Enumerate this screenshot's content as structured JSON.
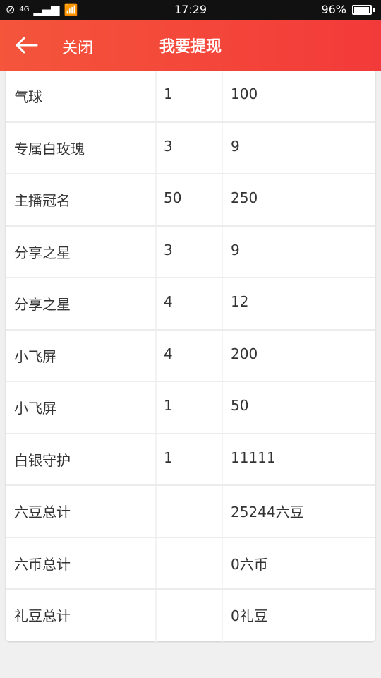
{
  "status": {
    "time": "17:29",
    "battery": "96%",
    "network": "4G"
  },
  "header": {
    "close_label": "关闭",
    "title": "我要提现"
  },
  "table": {
    "rows": [
      {
        "name": "气球",
        "qty": "1",
        "value": "100"
      },
      {
        "name": "专属白玫瑰",
        "qty": "3",
        "value": "9"
      },
      {
        "name": "主播冠名",
        "qty": "50",
        "value": "250"
      },
      {
        "name": "分享之星",
        "qty": "3",
        "value": "9"
      },
      {
        "name": "分享之星",
        "qty": "4",
        "value": "12"
      },
      {
        "name": "小飞屏",
        "qty": "4",
        "value": "200"
      },
      {
        "name": "小飞屏",
        "qty": "1",
        "value": "50"
      },
      {
        "name": "白银守护",
        "qty": "1",
        "value": "11111"
      },
      {
        "name": "六豆总计",
        "qty": "",
        "value": "25244六豆"
      },
      {
        "name": "六币总计",
        "qty": "",
        "value": "0六币"
      },
      {
        "name": "礼豆总计",
        "qty": "",
        "value": "0礼豆"
      }
    ]
  }
}
